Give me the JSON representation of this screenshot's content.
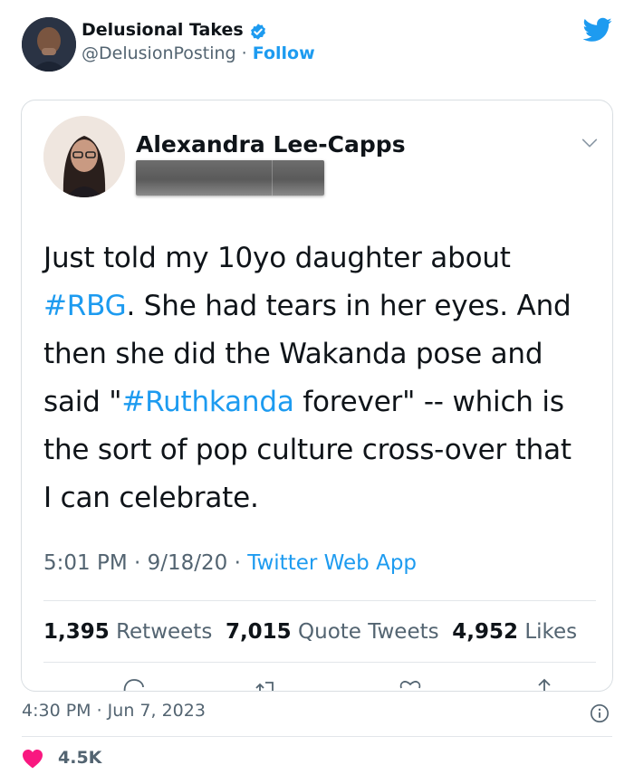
{
  "outer": {
    "name": "Delusional Takes",
    "handle": "@DelusionPosting",
    "separator": "·",
    "follow_label": "Follow",
    "timestamp": "4:30 PM · Jun 7, 2023",
    "likes": "4.5K"
  },
  "quoted": {
    "name": "Alexandra Lee-Capps",
    "text_lines": [
      [
        {
          "t": "Just told my 10yo daughter about",
          "tag": false
        }
      ],
      [
        {
          "t": "#RBG",
          "tag": true
        },
        {
          "t": ". She had tears in her eyes. And",
          "tag": false
        }
      ],
      [
        {
          "t": "then she did the Wakanda pose and",
          "tag": false
        }
      ],
      [
        {
          "t": "said \"",
          "tag": false
        },
        {
          "t": "#Ruthkanda",
          "tag": true
        },
        {
          "t": " forever\" -- which is",
          "tag": false
        }
      ],
      [
        {
          "t": "the sort of pop culture cross-over that",
          "tag": false
        }
      ],
      [
        {
          "t": "I can celebrate.",
          "tag": false
        }
      ]
    ],
    "time": "5:01 PM",
    "date": "9/18/20",
    "source": "Twitter Web App",
    "retweets": "1,395",
    "retweets_label": "Retweets",
    "quote_tweets": "7,015",
    "quote_tweets_label": "Quote Tweets",
    "likes": "4,952",
    "likes_label": "Likes"
  },
  "colors": {
    "accent": "#1d9bf0",
    "text": "#0f1419",
    "muted": "#536471",
    "heart": "#f91880"
  },
  "icons": [
    "verified-badge-icon",
    "twitter-bird-icon",
    "chevron-down-icon",
    "reply-icon",
    "retweet-icon",
    "like-icon",
    "share-icon",
    "info-icon",
    "heart-icon"
  ]
}
